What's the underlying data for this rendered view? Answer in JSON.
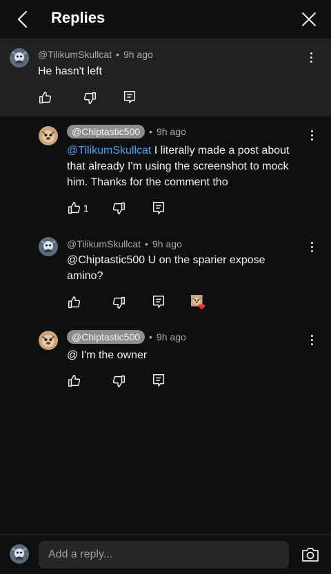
{
  "header": {
    "title": "Replies"
  },
  "parent_comment": {
    "author": "@TilikumSkullcat",
    "time": "9h ago",
    "text": "He hasn't left"
  },
  "replies": [
    {
      "author": "@Chiptastic500",
      "time": "9h ago",
      "mention": "@TilikumSkullcat",
      "text": " I literally made a post about that already I'm using the screenshot to mock him. Thanks for the comment tho",
      "likes": "1"
    },
    {
      "author": "@TilikumSkullcat",
      "time": "9h ago",
      "text": "@Chiptastic500  U on the sparier expose amino?",
      "hearted": true
    },
    {
      "author": "@Chiptastic500",
      "time": "9h ago",
      "text": "@ I'm the owner"
    }
  ],
  "composer": {
    "placeholder": "Add a reply..."
  },
  "colors": {
    "background": "#0f0f0f",
    "parent_bg": "#212121",
    "mention": "#3ea6ff",
    "chip": "#8d8d8d",
    "heart": "#ff2a2a"
  },
  "icons": [
    "back-arrow-icon",
    "close-icon",
    "thumbs-up-icon",
    "thumbs-down-icon",
    "reply-icon",
    "more-vert-icon",
    "camera-icon"
  ]
}
